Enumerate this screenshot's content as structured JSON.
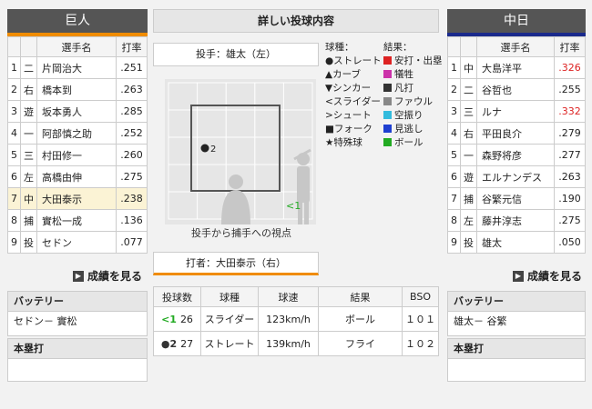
{
  "home": {
    "name": "巨人",
    "color": "#f08c00",
    "headers": [
      "選手名",
      "打率"
    ],
    "players": [
      {
        "no": "1",
        "pos": "二",
        "name": "片岡治大",
        "avg": ".251"
      },
      {
        "no": "2",
        "pos": "右",
        "name": "橋本到",
        "avg": ".263"
      },
      {
        "no": "3",
        "pos": "遊",
        "name": "坂本勇人",
        "avg": ".285"
      },
      {
        "no": "4",
        "pos": "一",
        "name": "阿部慎之助",
        "avg": ".252"
      },
      {
        "no": "5",
        "pos": "三",
        "name": "村田修一",
        "avg": ".260"
      },
      {
        "no": "6",
        "pos": "左",
        "name": "高橋由伸",
        "avg": ".275"
      },
      {
        "no": "7",
        "pos": "中",
        "name": "大田泰示",
        "avg": ".238"
      },
      {
        "no": "8",
        "pos": "捕",
        "name": "實松一成",
        "avg": ".136"
      },
      {
        "no": "9",
        "pos": "投",
        "name": "セドン",
        "avg": ".077"
      }
    ],
    "more": "成績を見る",
    "battery_label": "バッテリー",
    "battery": "セドン－ 實松",
    "hr_label": "本塁打",
    "hr": ""
  },
  "away": {
    "name": "中日",
    "color": "#1a2a8c",
    "headers": [
      "選手名",
      "打率"
    ],
    "players": [
      {
        "no": "1",
        "pos": "中",
        "name": "大島洋平",
        "avg": ".326"
      },
      {
        "no": "2",
        "pos": "二",
        "name": "谷哲也",
        "avg": ".255"
      },
      {
        "no": "3",
        "pos": "三",
        "name": "ルナ",
        "avg": ".332"
      },
      {
        "no": "4",
        "pos": "右",
        "name": "平田良介",
        "avg": ".279"
      },
      {
        "no": "5",
        "pos": "一",
        "name": "森野将彦",
        "avg": ".277"
      },
      {
        "no": "6",
        "pos": "遊",
        "name": "エルナンデス",
        "avg": ".263"
      },
      {
        "no": "7",
        "pos": "捕",
        "name": "谷繁元信",
        "avg": ".190"
      },
      {
        "no": "8",
        "pos": "左",
        "name": "藤井淳志",
        "avg": ".275"
      },
      {
        "no": "9",
        "pos": "投",
        "name": "雄太",
        "avg": ".050"
      }
    ],
    "more": "成績を見る",
    "battery_label": "バッテリー",
    "battery": "雄太－ 谷繁",
    "hr_label": "本塁打",
    "hr": ""
  },
  "center": {
    "title": "詳しい投球内容",
    "pitcher": "投手：雄太（左）",
    "batter": "打者：大田泰示（右）",
    "view_caption": "投手から捕手への視点",
    "pitch_marks": [
      {
        "label": "2",
        "symbol": "●"
      },
      {
        "label": "1",
        "symbol": "<"
      }
    ],
    "legend_types_title": "球種：",
    "legend_types": [
      "●ストレート",
      "▲カーブ",
      "▼シンカー",
      "<スライダー",
      ">シュート",
      "■フォーク",
      "★特殊球"
    ],
    "legend_results_title": "結果：",
    "legend_results": [
      {
        "label": "安打・出塁",
        "color": "#dd2222"
      },
      {
        "label": "犠牲",
        "color": "#cc33aa"
      },
      {
        "label": "凡打",
        "color": "#333333"
      },
      {
        "label": "ファウル",
        "color": "#888888"
      },
      {
        "label": "空振り",
        "color": "#33bbdd"
      },
      {
        "label": "見逃し",
        "color": "#1e3fd0"
      },
      {
        "label": "ボール",
        "color": "#22aa22"
      }
    ],
    "pitch_headers": [
      "投球数",
      "球種",
      "球速",
      "結果",
      "BSO"
    ],
    "pitches": [
      {
        "mark": "<1",
        "mark_color": "#22aa22",
        "count": "26",
        "type": "スライダー",
        "speed": "123km/h",
        "result": "ボール",
        "bso": "１０１"
      },
      {
        "mark": "●2",
        "mark_color": "#333333",
        "count": "27",
        "type": "ストレート",
        "speed": "139km/h",
        "result": "フライ",
        "bso": "１０２"
      }
    ]
  }
}
